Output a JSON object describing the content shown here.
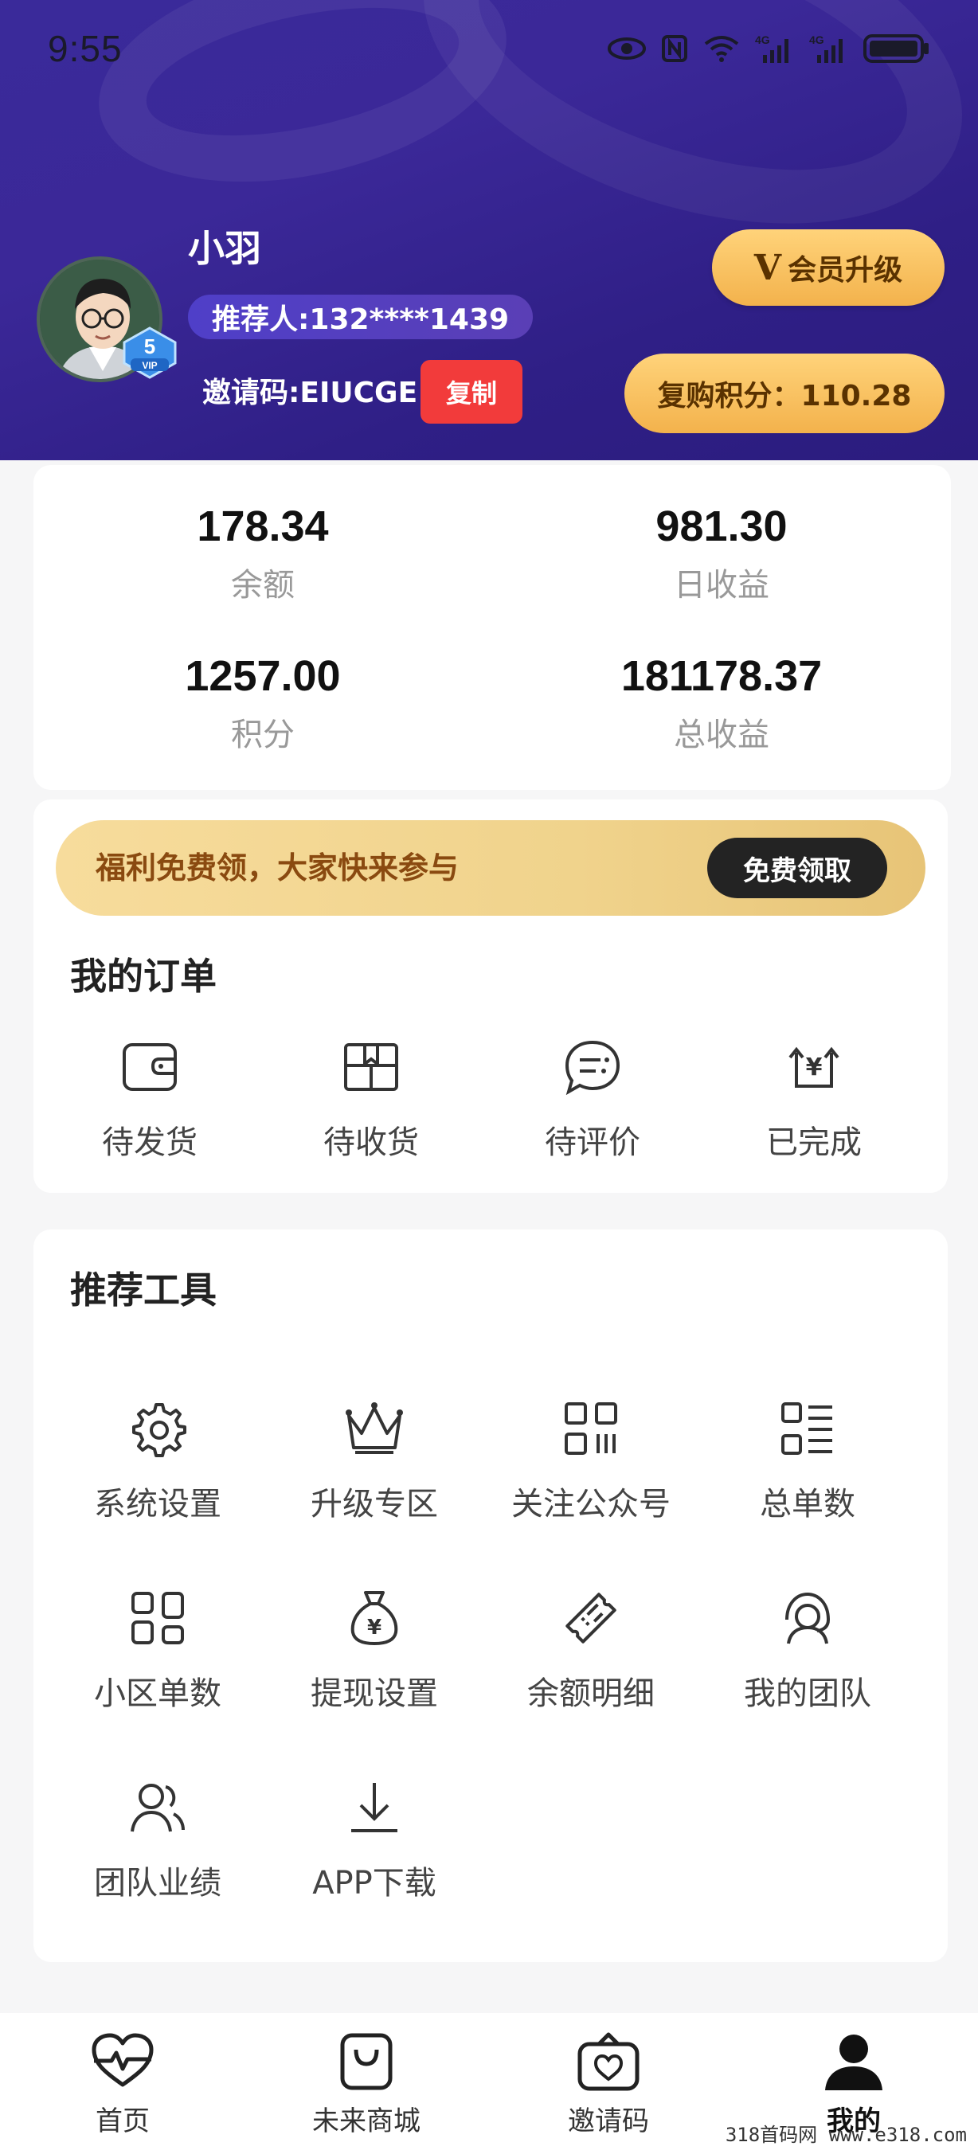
{
  "status_bar": {
    "time": "9:55",
    "icons": [
      "eye-icon",
      "nfc-icon",
      "wifi-icon",
      "signal-4g-icon",
      "signal-4g-icon",
      "battery-icon"
    ]
  },
  "profile": {
    "name": "小羽",
    "vip_level": "5",
    "vip_text": "VIP",
    "referrer": "推荐人:132****1439",
    "invite_code": "邀请码:EIUCGE",
    "copy_label": "复制",
    "upgrade_v": "V",
    "upgrade_label": "会员升级",
    "repurchase_label": "复购积分：110.28"
  },
  "stats": [
    {
      "value": "178.34",
      "label": "余额"
    },
    {
      "value": "981.30",
      "label": "日收益"
    },
    {
      "value": "1257.00",
      "label": "积分"
    },
    {
      "value": "181178.37",
      "label": "总收益"
    }
  ],
  "promo": {
    "text": "福利免费领，大家快来参与",
    "button": "免费领取"
  },
  "orders": {
    "title": "我的订单",
    "items": [
      {
        "label": "待发货",
        "icon": "wallet-icon"
      },
      {
        "label": "待收货",
        "icon": "package-icon"
      },
      {
        "label": "待评价",
        "icon": "comment-icon"
      },
      {
        "label": "已完成",
        "icon": "yen-exchange-icon"
      }
    ]
  },
  "tools": {
    "title": "推荐工具",
    "items": [
      {
        "label": "系统设置",
        "icon": "gear-icon"
      },
      {
        "label": "升级专区",
        "icon": "crown-icon"
      },
      {
        "label": "关注公众号",
        "icon": "qrcode-icon"
      },
      {
        "label": "总单数",
        "icon": "list-icon"
      },
      {
        "label": "小区单数",
        "icon": "grid-icon"
      },
      {
        "label": "提现设置",
        "icon": "money-bag-icon"
      },
      {
        "label": "余额明细",
        "icon": "ticket-icon"
      },
      {
        "label": "我的团队",
        "icon": "headset-user-icon"
      },
      {
        "label": "团队业绩",
        "icon": "users-icon"
      },
      {
        "label": "APP下载",
        "icon": "download-icon"
      }
    ]
  },
  "bottom_nav": [
    {
      "label": "首页",
      "icon": "heart-pulse-icon"
    },
    {
      "label": "未来商城",
      "icon": "shopping-bag-icon"
    },
    {
      "label": "邀请码",
      "icon": "gift-box-icon"
    },
    {
      "label": "我的",
      "icon": "person-icon"
    }
  ],
  "watermark": "318首码网  www.e318.com",
  "colors": {
    "header": "#3a2a9a",
    "gold": "#f3b24c",
    "copy_red": "#f23b3b"
  }
}
